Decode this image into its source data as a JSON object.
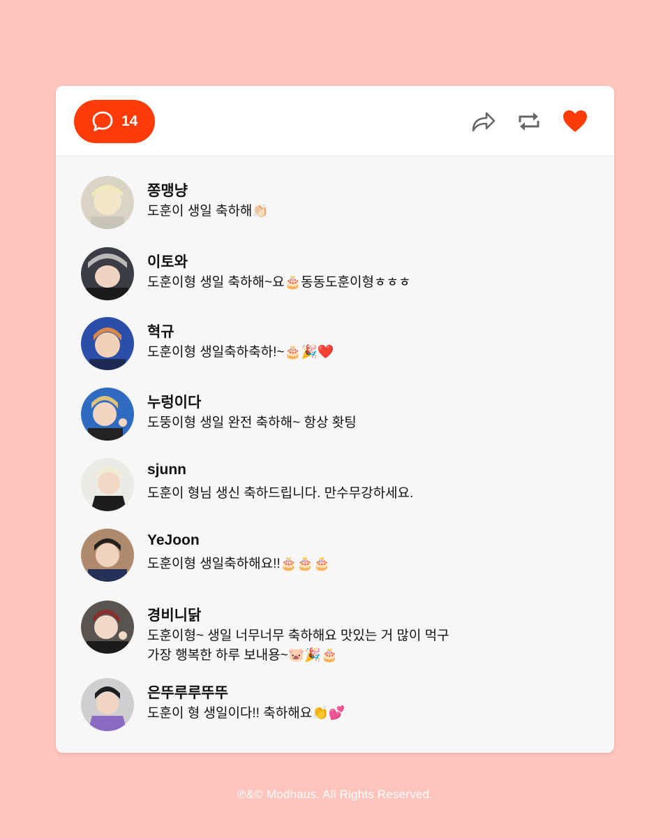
{
  "colors": {
    "background": "#ffc4bc",
    "accent": "#ff3b0a",
    "card": "#f7f7f7",
    "header": "#ffffff",
    "icon_gray": "#666666"
  },
  "header": {
    "comment_icon": "speech-bubble-icon",
    "comment_count": "14",
    "actions": [
      {
        "icon": "share-arrow-icon"
      },
      {
        "icon": "repost-icon"
      },
      {
        "icon": "heart-icon",
        "color": "#ff3b0a"
      }
    ]
  },
  "comments": [
    {
      "username": "쫑맹냥",
      "text": "도훈이 생일 축하해👏🏻"
    },
    {
      "username": "이토와",
      "text": "도훈이형 생일 축하해~요🎂동동도훈이형ㅎㅎㅎ"
    },
    {
      "username": "혁규",
      "text": "도훈이형 생일축하축하!~🎂🎉❤️"
    },
    {
      "username": "누렁이다",
      "text": "도뚱이형 생일 완전 축하해~ 항상 홧팅"
    },
    {
      "username": "sjunn",
      "text": "도훈이 형님 생신 축하드립니다. 만수무강하세요."
    },
    {
      "username": "YeJoon",
      "text": "도훈이형 생일축하해요!!🎂🎂🎂"
    },
    {
      "username": "경비니닭",
      "text": "도훈이형~ 생일 너무너무 축하해요 맛있는 거 많이 먹구\n가장 행복한 하루 보내용~🐷🎉🎂"
    },
    {
      "username": "은뚜루루뚜뚜",
      "text": "도훈이 형 생일이다!! 축하해요👏💕"
    }
  ],
  "footer": {
    "copyright": "℗&© Modhaus. All Rights Reserved."
  }
}
